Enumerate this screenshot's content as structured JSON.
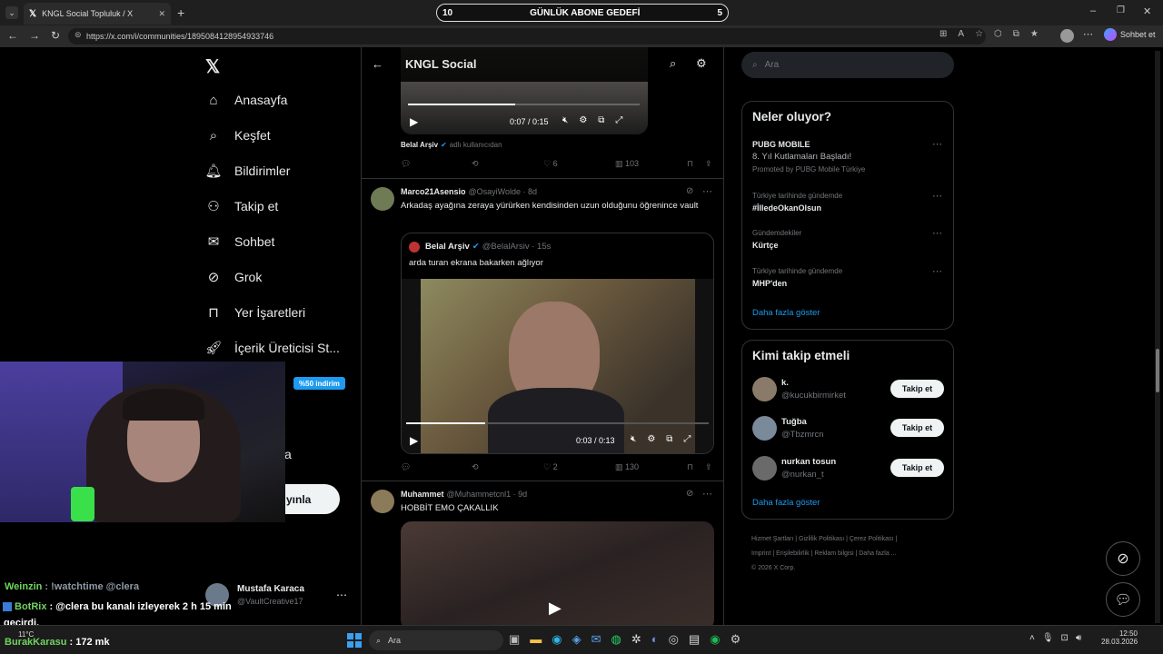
{
  "browser": {
    "tab_title": "KNGL Social Topluluk / X",
    "url": "https://x.com/i/communities/1895084128954933746",
    "goal_left": "10",
    "goal_title": "GÜNLÜK ABONE GEDEFİ",
    "goal_right": "5",
    "copilot_label": "Sohbet et"
  },
  "nav": {
    "items": [
      {
        "label": "Anasayfa",
        "icon": "home-icon"
      },
      {
        "label": "Keşfet",
        "icon": "search-icon"
      },
      {
        "label": "Bildirimler",
        "icon": "bell-icon"
      },
      {
        "label": "Takip et",
        "icon": "add-person-icon"
      },
      {
        "label": "Sohbet",
        "icon": "mail-icon"
      },
      {
        "label": "Grok",
        "icon": "grok-icon"
      },
      {
        "label": "Yer İşaretleri",
        "icon": "bookmark-icon"
      },
      {
        "label": "İçerik Üreticisi St...",
        "icon": "rocket-icon"
      }
    ],
    "discount_badge": "%50 indirim",
    "partial_label": "a",
    "post_button": "yınla",
    "profile_name": "Mustafa Karaca",
    "profile_handle": "@VaultCreative17"
  },
  "timeline": {
    "title": "KNGL Social",
    "tweet0": {
      "video_time": "0:07 / 0:15",
      "source_name": "Belal Arşiv",
      "source_suffix": "adlı kullanıcıdan",
      "likes": "6",
      "views": "103"
    },
    "tweet1": {
      "name": "Marco21Asensio",
      "handle_time": "@OsayiWolde · 8d",
      "text": "Arkadaş ayağına zeraya yürürken kendisinden uzun olduğunu öğrenince vault",
      "quote_name": "Belal Arşiv",
      "quote_handle_time": "@BelalArsiv · 15s",
      "quote_text": "arda turan ekrana bakarken ağlıyor",
      "video_time": "0:03 / 0:13",
      "likes": "2",
      "views": "130"
    },
    "tweet2": {
      "name": "Muhammet",
      "handle_time": "@Muhammetcnl1 · 9d",
      "text": "HOBBİT EMO ÇAKALLIK"
    }
  },
  "right": {
    "search_placeholder": "Ara",
    "trends_title": "Neler oluyor?",
    "promo_name": "PUBG MOBILE",
    "promo_text": "8. Yıl Kutlamaları Başladı!",
    "promo_by": "Promoted by PUBG Mobile Türkiye",
    "trends": [
      {
        "context": "Türkiye tarihinde gündemde",
        "name": "#İlledeOkanOlsun"
      },
      {
        "context": "Gündemdekiler",
        "name": "Kürtçe"
      },
      {
        "context": "Türkiye tarihinde gündemde",
        "name": "MHP'den"
      }
    ],
    "show_more": "Daha fazla göster",
    "follow_title": "Kimi takip etmeli",
    "follow": [
      {
        "name": "k.",
        "handle": "@kucukbirmirket",
        "button": "Takip et"
      },
      {
        "name": "Tuğba",
        "handle": "@Tbzmrcn",
        "button": "Takip et"
      },
      {
        "name": "nurkan tosun",
        "handle": "@nurkan_t",
        "button": "Takip et"
      }
    ],
    "footer_line1": "Hizmet Şartları  |  Gizlilik Politikası  |  Çerez Politikası  |",
    "footer_line2": "Imprint  |  Erişilebilirlik  |  Reklam bilgisi  |  Daha fazla ...",
    "footer_line3": "© 2026 X Corp."
  },
  "chat": {
    "line1_user": "Weinzin",
    "line1_text": ": !watchtime @clera",
    "line2_user": "BotRix",
    "line2_text": ": @clera bu kanalı izleyerek 2 h 15 min",
    "line3_text": "geçirdi.",
    "line4_user": "BurakKarasu",
    "line4_text": ": 172 mk"
  },
  "taskbar": {
    "search": "Ara",
    "weather": "11°C",
    "time": "12:50",
    "date": "28.03.2026"
  },
  "colors": {
    "accent": "#1d9bf0",
    "badge": "#1d9bf0",
    "bg": "#000000"
  }
}
